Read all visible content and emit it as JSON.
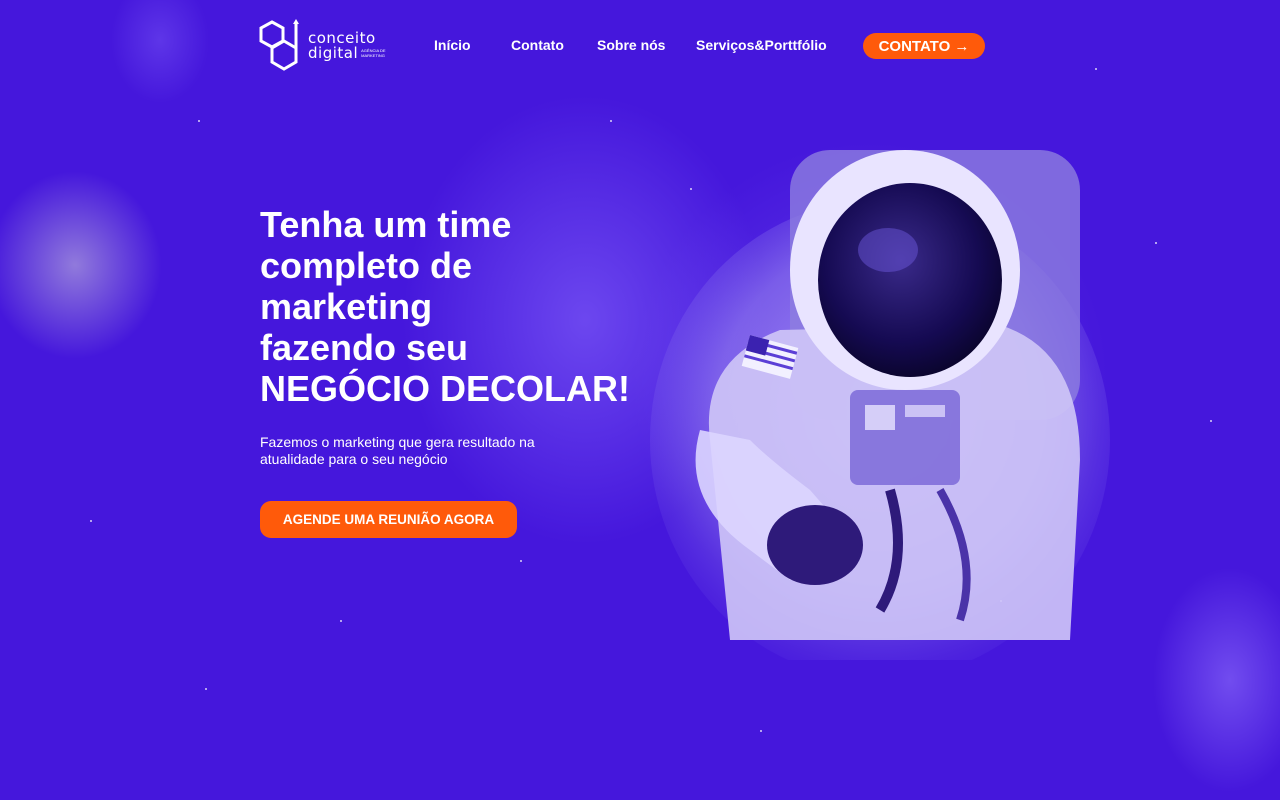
{
  "brand": {
    "name_line1": "conceito",
    "name_line2": "digital",
    "tagline": "AGÊNCIA DE MARKETING"
  },
  "nav": {
    "items": [
      {
        "label": "Início"
      },
      {
        "label": "Contato"
      },
      {
        "label": "Sobre nós"
      },
      {
        "label": "Serviços&Porttfólio"
      }
    ],
    "cta_label": "CONTATO →"
  },
  "hero": {
    "title_lines": [
      "Tenha um time",
      "completo de",
      "marketing",
      "fazendo seu",
      "NEGÓCIO DECOLAR!"
    ],
    "subtitle": "Fazemos o marketing que gera resultado na atualidade para o seu negócio",
    "cta_label": "AGENDE UMA REUNIÃO AGORA"
  },
  "colors": {
    "background": "#4517dc",
    "accent": "#ff5a0a",
    "text": "#ffffff"
  },
  "icons": {
    "logo": "hexagon-logo-icon",
    "illustration": "astronaut-illustration"
  }
}
